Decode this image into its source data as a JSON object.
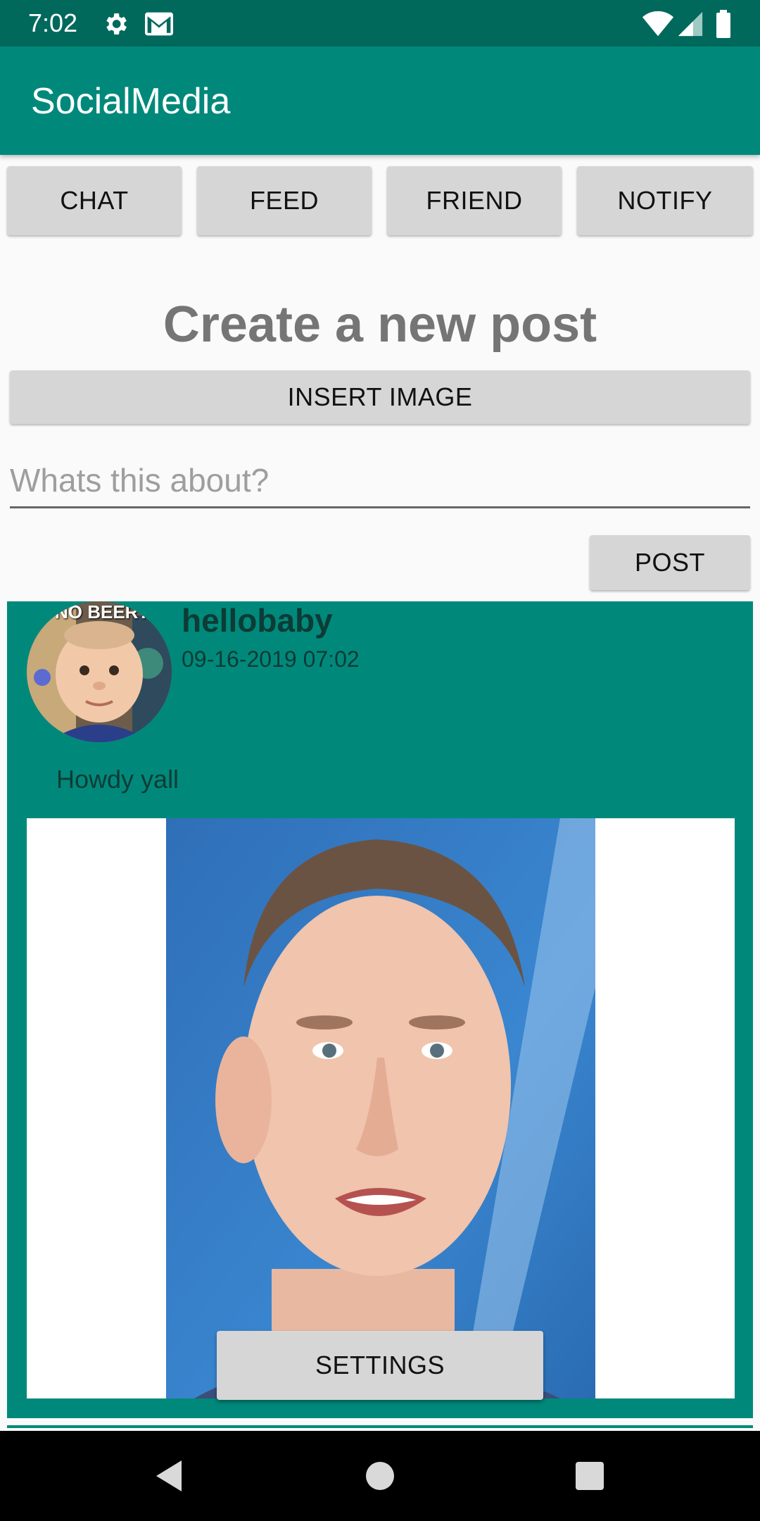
{
  "status_bar": {
    "time": "7:02",
    "icons": [
      "gear-icon",
      "gmail-icon",
      "wifi-icon",
      "cell-signal-icon",
      "battery-icon"
    ]
  },
  "app_bar": {
    "title": "SocialMedia"
  },
  "nav_buttons": [
    {
      "label": "CHAT"
    },
    {
      "label": "FEED"
    },
    {
      "label": "FRIEND"
    },
    {
      "label": "NOTIFY"
    }
  ],
  "create_post": {
    "heading": "Create a new post",
    "insert_image_label": "INSERT IMAGE",
    "input_placeholder": "Whats this about?",
    "input_value": "",
    "post_label": "POST"
  },
  "post": {
    "username": "hellobaby",
    "timestamp": "09-16-2019 07:02",
    "text": "Howdy yall",
    "avatar_caption": "NO BEER?"
  },
  "settings_label": "SETTINGS",
  "colors": {
    "primary": "#00897b",
    "primary_dark": "#00695c",
    "button": "#d6d6d6",
    "heading": "#757575"
  },
  "system_nav": [
    "back-icon",
    "home-icon",
    "recents-icon"
  ]
}
